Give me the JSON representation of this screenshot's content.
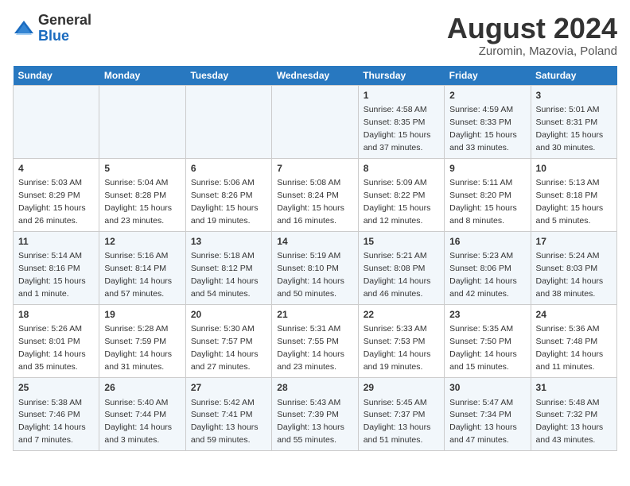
{
  "header": {
    "logo_line1": "General",
    "logo_line2": "Blue",
    "month_year": "August 2024",
    "location": "Zuromin, Mazovia, Poland"
  },
  "days_of_week": [
    "Sunday",
    "Monday",
    "Tuesday",
    "Wednesday",
    "Thursday",
    "Friday",
    "Saturday"
  ],
  "weeks": [
    [
      {
        "day": "",
        "info": ""
      },
      {
        "day": "",
        "info": ""
      },
      {
        "day": "",
        "info": ""
      },
      {
        "day": "",
        "info": ""
      },
      {
        "day": "1",
        "info": "Sunrise: 4:58 AM\nSunset: 8:35 PM\nDaylight: 15 hours\nand 37 minutes."
      },
      {
        "day": "2",
        "info": "Sunrise: 4:59 AM\nSunset: 8:33 PM\nDaylight: 15 hours\nand 33 minutes."
      },
      {
        "day": "3",
        "info": "Sunrise: 5:01 AM\nSunset: 8:31 PM\nDaylight: 15 hours\nand 30 minutes."
      }
    ],
    [
      {
        "day": "4",
        "info": "Sunrise: 5:03 AM\nSunset: 8:29 PM\nDaylight: 15 hours\nand 26 minutes."
      },
      {
        "day": "5",
        "info": "Sunrise: 5:04 AM\nSunset: 8:28 PM\nDaylight: 15 hours\nand 23 minutes."
      },
      {
        "day": "6",
        "info": "Sunrise: 5:06 AM\nSunset: 8:26 PM\nDaylight: 15 hours\nand 19 minutes."
      },
      {
        "day": "7",
        "info": "Sunrise: 5:08 AM\nSunset: 8:24 PM\nDaylight: 15 hours\nand 16 minutes."
      },
      {
        "day": "8",
        "info": "Sunrise: 5:09 AM\nSunset: 8:22 PM\nDaylight: 15 hours\nand 12 minutes."
      },
      {
        "day": "9",
        "info": "Sunrise: 5:11 AM\nSunset: 8:20 PM\nDaylight: 15 hours\nand 8 minutes."
      },
      {
        "day": "10",
        "info": "Sunrise: 5:13 AM\nSunset: 8:18 PM\nDaylight: 15 hours\nand 5 minutes."
      }
    ],
    [
      {
        "day": "11",
        "info": "Sunrise: 5:14 AM\nSunset: 8:16 PM\nDaylight: 15 hours\nand 1 minute."
      },
      {
        "day": "12",
        "info": "Sunrise: 5:16 AM\nSunset: 8:14 PM\nDaylight: 14 hours\nand 57 minutes."
      },
      {
        "day": "13",
        "info": "Sunrise: 5:18 AM\nSunset: 8:12 PM\nDaylight: 14 hours\nand 54 minutes."
      },
      {
        "day": "14",
        "info": "Sunrise: 5:19 AM\nSunset: 8:10 PM\nDaylight: 14 hours\nand 50 minutes."
      },
      {
        "day": "15",
        "info": "Sunrise: 5:21 AM\nSunset: 8:08 PM\nDaylight: 14 hours\nand 46 minutes."
      },
      {
        "day": "16",
        "info": "Sunrise: 5:23 AM\nSunset: 8:06 PM\nDaylight: 14 hours\nand 42 minutes."
      },
      {
        "day": "17",
        "info": "Sunrise: 5:24 AM\nSunset: 8:03 PM\nDaylight: 14 hours\nand 38 minutes."
      }
    ],
    [
      {
        "day": "18",
        "info": "Sunrise: 5:26 AM\nSunset: 8:01 PM\nDaylight: 14 hours\nand 35 minutes."
      },
      {
        "day": "19",
        "info": "Sunrise: 5:28 AM\nSunset: 7:59 PM\nDaylight: 14 hours\nand 31 minutes."
      },
      {
        "day": "20",
        "info": "Sunrise: 5:30 AM\nSunset: 7:57 PM\nDaylight: 14 hours\nand 27 minutes."
      },
      {
        "day": "21",
        "info": "Sunrise: 5:31 AM\nSunset: 7:55 PM\nDaylight: 14 hours\nand 23 minutes."
      },
      {
        "day": "22",
        "info": "Sunrise: 5:33 AM\nSunset: 7:53 PM\nDaylight: 14 hours\nand 19 minutes."
      },
      {
        "day": "23",
        "info": "Sunrise: 5:35 AM\nSunset: 7:50 PM\nDaylight: 14 hours\nand 15 minutes."
      },
      {
        "day": "24",
        "info": "Sunrise: 5:36 AM\nSunset: 7:48 PM\nDaylight: 14 hours\nand 11 minutes."
      }
    ],
    [
      {
        "day": "25",
        "info": "Sunrise: 5:38 AM\nSunset: 7:46 PM\nDaylight: 14 hours\nand 7 minutes."
      },
      {
        "day": "26",
        "info": "Sunrise: 5:40 AM\nSunset: 7:44 PM\nDaylight: 14 hours\nand 3 minutes."
      },
      {
        "day": "27",
        "info": "Sunrise: 5:42 AM\nSunset: 7:41 PM\nDaylight: 13 hours\nand 59 minutes."
      },
      {
        "day": "28",
        "info": "Sunrise: 5:43 AM\nSunset: 7:39 PM\nDaylight: 13 hours\nand 55 minutes."
      },
      {
        "day": "29",
        "info": "Sunrise: 5:45 AM\nSunset: 7:37 PM\nDaylight: 13 hours\nand 51 minutes."
      },
      {
        "day": "30",
        "info": "Sunrise: 5:47 AM\nSunset: 7:34 PM\nDaylight: 13 hours\nand 47 minutes."
      },
      {
        "day": "31",
        "info": "Sunrise: 5:48 AM\nSunset: 7:32 PM\nDaylight: 13 hours\nand 43 minutes."
      }
    ]
  ]
}
